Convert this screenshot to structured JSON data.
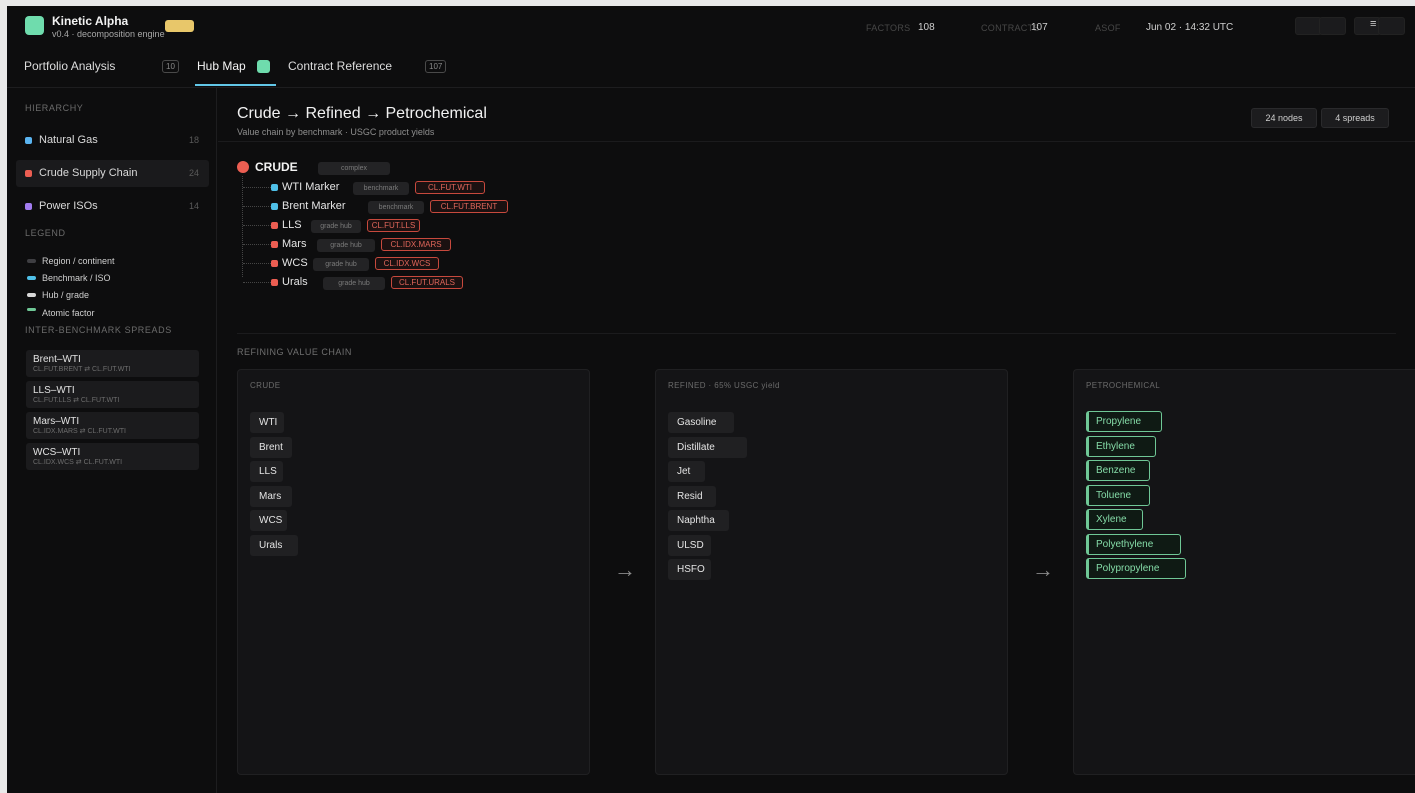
{
  "colors": {
    "brand": "#6fdcad",
    "brand_pill": "#e8c76a",
    "accent": "#62c7e8",
    "natural_gas": "#5ab4f0",
    "crude": "#ec5e52",
    "power": "#a27cf0",
    "benchmark": "#4fc0e8",
    "petro": "#6fc796"
  },
  "app": {
    "title": "Kinetic Alpha",
    "subtitle": "v0.4 · decomposition engine"
  },
  "stats": {
    "factors_label": "FACTORS",
    "factors_value": "108",
    "contracts_label": "CONTRACTS",
    "contracts_value": "107",
    "asof_label": "ASOF",
    "asof_value": "Jun 02 · 14:32 UTC"
  },
  "toolbar": {
    "menu_icon": "≡"
  },
  "nav": {
    "tabs": [
      {
        "label": "Portfolio Analysis",
        "badge": "10"
      },
      {
        "label": "Hub Map"
      },
      {
        "label": "Contract Reference",
        "badge": "107"
      }
    ]
  },
  "sidebar": {
    "hierarchy_header": "HIERARCHY",
    "hierarchy": [
      {
        "label": "Natural Gas",
        "count": "18"
      },
      {
        "label": "Crude Supply Chain",
        "count": "24"
      },
      {
        "label": "Power ISOs",
        "count": "14"
      }
    ],
    "legend_header": "LEGEND",
    "legend": [
      {
        "label": "Region / continent",
        "color": "#3e3e42"
      },
      {
        "label": "Benchmark / ISO",
        "color": "#4fc0e8"
      },
      {
        "label": "Hub / grade",
        "color": "#d8d8d8"
      },
      {
        "label": "Atomic factor",
        "color": "#6fc796"
      }
    ],
    "spreads_header": "INTER-BENCHMARK SPREADS",
    "spreads": [
      {
        "name": "Brent–WTI",
        "sub": "CL.FUT.BRENT ⇄ CL.FUT.WTI"
      },
      {
        "name": "LLS–WTI",
        "sub": "CL.FUT.LLS ⇄ CL.FUT.WTI"
      },
      {
        "name": "Mars–WTI",
        "sub": "CL.IDX.MARS ⇄ CL.FUT.WTI"
      },
      {
        "name": "WCS–WTI",
        "sub": "CL.IDX.WCS ⇄ CL.FUT.WTI"
      }
    ]
  },
  "main": {
    "title": "Crude → Refined → Petrochemical",
    "subtitle": "Value chain by benchmark · USGC product yields",
    "nodes_btn": "24 nodes",
    "spreads_btn": "4 spreads",
    "tree": {
      "root": {
        "label": "CRUDE",
        "tag": "complex"
      },
      "children": [
        {
          "label": "WTI Marker",
          "tag": "benchmark",
          "code": "CL.FUT.WTI"
        },
        {
          "label": "Brent Marker",
          "tag": "benchmark",
          "code": "CL.FUT.BRENT"
        },
        {
          "label": "LLS",
          "tag": "grade hub",
          "code": "CL.FUT.LLS"
        },
        {
          "label": "Mars",
          "tag": "grade hub",
          "code": "CL.IDX.MARS"
        },
        {
          "label": "WCS",
          "tag": "grade hub",
          "code": "CL.IDX.WCS"
        },
        {
          "label": "Urals",
          "tag": "grade hub",
          "code": "CL.FUT.URALS"
        }
      ]
    },
    "chain_header": "REFINING VALUE CHAIN",
    "arrow": "→",
    "columns": {
      "crude": {
        "header": "CRUDE",
        "items": [
          "WTI",
          "Brent",
          "LLS",
          "Mars",
          "WCS",
          "Urals"
        ]
      },
      "refined": {
        "header": "REFINED · 65% USGC yield",
        "items": [
          "Gasoline",
          "Distillate",
          "Jet",
          "Resid",
          "Naphtha",
          "ULSD",
          "HSFO"
        ]
      },
      "petro": {
        "header": "PETROCHEMICAL",
        "items": [
          "Propylene",
          "Ethylene",
          "Benzene",
          "Toluene",
          "Xylene",
          "Polyethylene",
          "Polypropylene"
        ]
      }
    }
  }
}
